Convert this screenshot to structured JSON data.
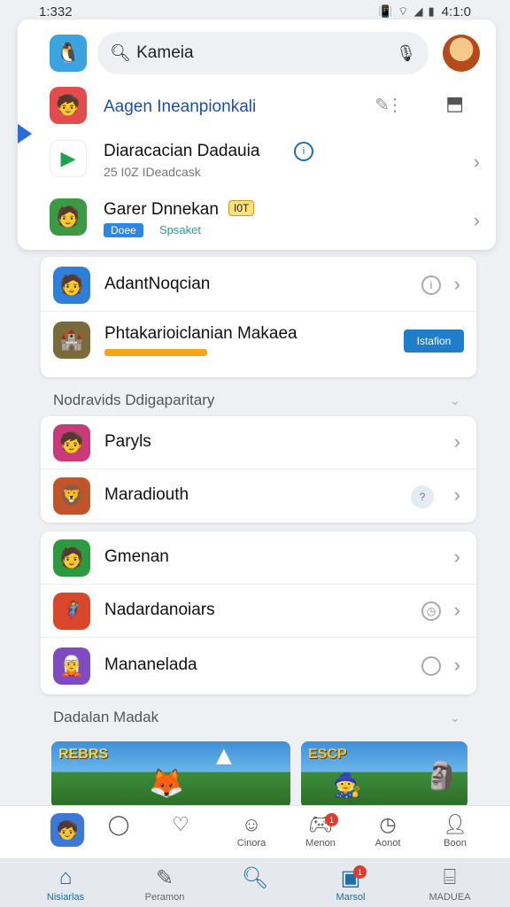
{
  "status_bar": {
    "time": "1:332",
    "right_text": "4:1:0",
    "icons": [
      "vibrate-icon",
      "wifi-icon",
      "signal-icon",
      "battery-icon"
    ]
  },
  "search": {
    "query": "Kameia",
    "placeholder": "Kameia"
  },
  "top_panel": {
    "rows": [
      {
        "title": "Aagen Ineanpionkali",
        "subtitle": "",
        "title_color": "#1f4fa8"
      },
      {
        "title": "Diaracacian Dadauia",
        "subtitle": "25 I0Z IDeadcask"
      },
      {
        "title": "Garer Dnnekan",
        "tag": "I0T",
        "sub_chip_1": "Doee",
        "sub_chip_2": "Spsaket"
      }
    ]
  },
  "card_1": {
    "rows": [
      {
        "title": "AdantNoqcian"
      },
      {
        "title": "Phtakarioiclanian Makaea",
        "button": "Istafion"
      }
    ]
  },
  "section_1": {
    "label": "Nodravids Ddigaparitary"
  },
  "card_2": {
    "rows": [
      {
        "title": "Paryls"
      },
      {
        "title": "Maradiouth",
        "badge": "?"
      }
    ]
  },
  "card_3": {
    "rows": [
      {
        "title": "Gmenan"
      },
      {
        "title": "Nadardanoiars"
      },
      {
        "title": "Mananelada"
      }
    ]
  },
  "section_2": {
    "label": "Dadalan Madak"
  },
  "banners": [
    {
      "title": "REBRS"
    },
    {
      "title": "ESCP"
    }
  ],
  "shelf": [
    {
      "label": "",
      "icon": "app-icon"
    },
    {
      "label": "",
      "icon": "chat-icon"
    },
    {
      "label": "",
      "icon": "heart-icon"
    },
    {
      "label": "Cinora",
      "icon": "person-icon"
    },
    {
      "label": "Menon",
      "icon": "gamepad-icon",
      "badge": "1"
    },
    {
      "label": "Aonot",
      "icon": "clock-icon"
    },
    {
      "label": "Boon",
      "icon": "profile-icon"
    }
  ],
  "bottom_nav": [
    {
      "label": "Nisiarlas",
      "icon": "home-icon",
      "active": true
    },
    {
      "label": "Peramon",
      "icon": "edit-icon"
    },
    {
      "label": "",
      "icon": "search-icon"
    },
    {
      "label": "Marsol",
      "icon": "inbox-icon",
      "badge": "1"
    },
    {
      "label": "MADUEA",
      "icon": "archive-icon"
    }
  ]
}
